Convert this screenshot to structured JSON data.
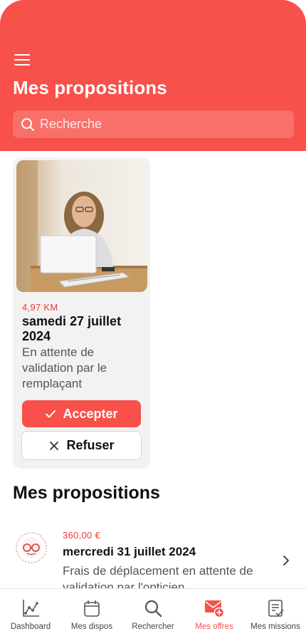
{
  "header": {
    "title": "Mes propositions",
    "search_placeholder": "Recherche"
  },
  "card": {
    "distance": "4,97 KM",
    "date": "samedi 27 juillet 2024",
    "status": "En attente de validation par le remplaçant",
    "accept_label": "Accepter",
    "refuse_label": "Refuser"
  },
  "section": {
    "title": "Mes propositions"
  },
  "list": [
    {
      "price": "360,00 €",
      "date": "mercredi 31 juillet 2024",
      "status": "Frais de déplacement en attente de validation par l'opticien"
    }
  ],
  "tabbar": {
    "items": [
      {
        "label": "Dashboard",
        "icon": "chart-icon",
        "active": false
      },
      {
        "label": "Mes dispos",
        "icon": "calendar-icon",
        "active": false
      },
      {
        "label": "Rechercher",
        "icon": "search-icon",
        "active": false
      },
      {
        "label": "Mes offres",
        "icon": "mail-add-icon",
        "active": true
      },
      {
        "label": "Mes missions",
        "icon": "clipboard-icon",
        "active": false
      }
    ]
  },
  "colors": {
    "accent": "#f8504a",
    "price": "#e63d36"
  }
}
